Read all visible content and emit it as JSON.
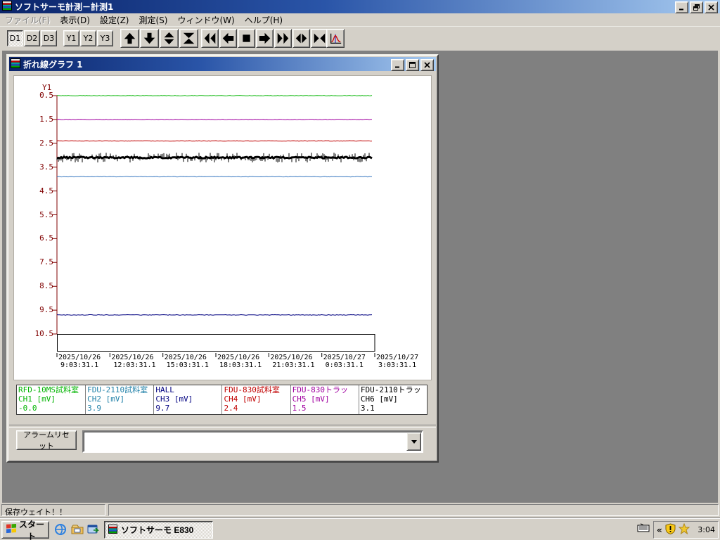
{
  "window": {
    "title": "ソフトサーモ計測－計測1"
  },
  "menu_bar": {
    "items": [
      {
        "label": "ファイル(F)",
        "enabled": false
      },
      {
        "label": "表示(D)",
        "enabled": true
      },
      {
        "label": "設定(Z)",
        "enabled": true
      },
      {
        "label": "測定(S)",
        "enabled": true
      },
      {
        "label": "ウィンドウ(W)",
        "enabled": true
      },
      {
        "label": "ヘルプ(H)",
        "enabled": true
      }
    ]
  },
  "toolbar": {
    "toggle_buttons": [
      {
        "label": "D1",
        "pressed": true
      },
      {
        "label": "D2",
        "pressed": false
      },
      {
        "label": "D3",
        "pressed": false
      },
      {
        "label": "Y1",
        "pressed": false
      },
      {
        "label": "Y2",
        "pressed": false
      },
      {
        "label": "Y3",
        "pressed": false
      }
    ]
  },
  "graph_window": {
    "title": "折れ線グラフ 1",
    "alarm_reset_label": "アラームリセット",
    "alarm_combo_value": ""
  },
  "chart_data": {
    "type": "line",
    "title": "折れ線グラフ 1",
    "y_axis": {
      "label": "Y1",
      "min": 0.5,
      "max": 10.5,
      "inverted": true,
      "axis_color": "#800000",
      "ticks": [
        "0.5",
        "1.5",
        "2.5",
        "3.5",
        "4.5",
        "5.5",
        "6.5",
        "7.5",
        "8.5",
        "9.5",
        "10.5"
      ]
    },
    "x_axis": {
      "ticks": [
        {
          "date": "2025/10/26",
          "time": "9:03:31.1"
        },
        {
          "date": "2025/10/26",
          "time": "12:03:31.1"
        },
        {
          "date": "2025/10/26",
          "time": "15:03:31.1"
        },
        {
          "date": "2025/10/26",
          "time": "18:03:31.1"
        },
        {
          "date": "2025/10/26",
          "time": "21:03:31.1"
        },
        {
          "date": "2025/10/27",
          "time": "0:03:31.1"
        },
        {
          "date": "2025/10/27",
          "time": "3:03:31.1"
        }
      ]
    },
    "series": [
      {
        "name": "CH1",
        "label": "RFD-10MS試料室",
        "unit": "mV",
        "value": -0.0,
        "color": "#00b400",
        "noisy": false
      },
      {
        "name": "CH5",
        "label": "FDU-830トラッ",
        "unit": "mV",
        "value": 1.5,
        "color": "#a000a0",
        "noisy": false
      },
      {
        "name": "CH4",
        "label": "FDU-830試料室",
        "unit": "mV",
        "value": 2.4,
        "color": "#c00000",
        "noisy": false
      },
      {
        "name": "CH6",
        "label": "FDU-2110トラッ",
        "unit": "mV",
        "value": 3.1,
        "color": "#000000",
        "noisy": true
      },
      {
        "name": "CH2",
        "label": "FDU-2110試料室",
        "unit": "mV",
        "value": 3.9,
        "color": "#3878c0",
        "noisy": false
      },
      {
        "name": "CH3",
        "label": "HALL",
        "unit": "mV",
        "value": 9.7,
        "color": "#000080",
        "noisy": false
      }
    ]
  },
  "legend": {
    "channels": [
      {
        "name": "RFD-10MS試料室",
        "ch": "CH1 [mV]",
        "value": "-0.0",
        "color": "#00b400"
      },
      {
        "name": "FDU-2110試料室",
        "ch": "CH2 [mV]",
        "value": "3.9",
        "color": "#2080a8"
      },
      {
        "name": "HALL",
        "ch": "CH3 [mV]",
        "value": "9.7",
        "color": "#000080"
      },
      {
        "name": "FDU-830試料室",
        "ch": "CH4 [mV]",
        "value": "2.4",
        "color": "#c00000"
      },
      {
        "name": "FDU-830トラッ",
        "ch": "CH5 [mV]",
        "value": "1.5",
        "color": "#a000a0"
      },
      {
        "name": "FDU-2110トラッ",
        "ch": "CH6 [mV]",
        "value": "3.1",
        "color": "#000000"
      }
    ]
  },
  "status_bar": {
    "message": "保存ウェイト！！"
  },
  "taskbar": {
    "start_label": "スタート",
    "task_button": {
      "label": "ソフトサーモ E830"
    },
    "tray": {
      "chevron": "«",
      "clock": "3:04"
    }
  }
}
